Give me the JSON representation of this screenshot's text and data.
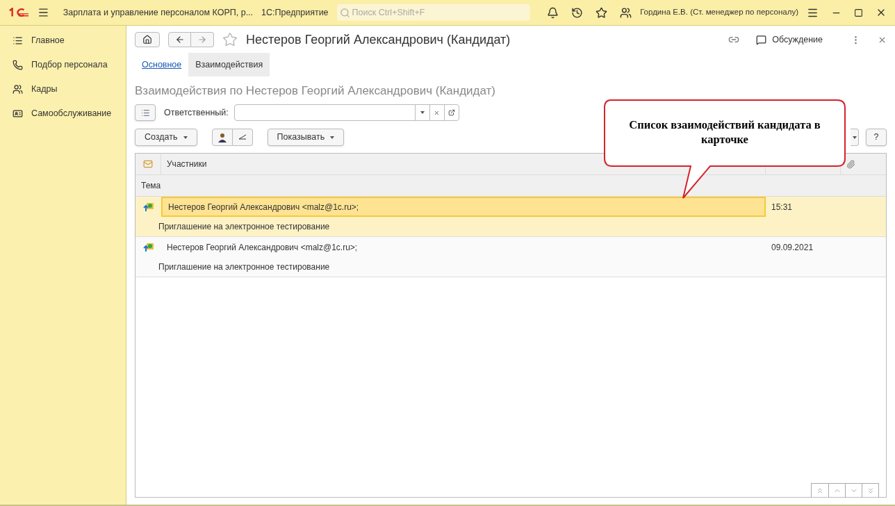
{
  "titlebar": {
    "app_title": "Зарплата и управление персоналом КОРП, р...",
    "platform": "1С:Предприятие",
    "search": {
      "placeholder": "Поиск Ctrl+Shift+F"
    },
    "user": "Гордина Е.В. (Ст. менеджер по персоналу)"
  },
  "sidebar": {
    "items": [
      {
        "label": "Главное",
        "selected": false
      },
      {
        "label": "Подбор персонала",
        "selected": false
      },
      {
        "label": "Кадры",
        "selected": false
      },
      {
        "label": "Самообслуживание",
        "selected": false
      }
    ]
  },
  "form": {
    "title": "Нестеров Георгий Александрович (Кандидат)",
    "discussion": "Обсуждение",
    "tabs": [
      {
        "label": "Основное",
        "selected": false
      },
      {
        "label": "Взаимодействия",
        "selected": true
      }
    ],
    "heading": "Взаимодействия по Нестеров Георгий Александрович (Кандидат)",
    "responsible_label": "Ответственный:",
    "buttons": {
      "create": "Создать",
      "show": "Показывать",
      "help": "?"
    },
    "table": {
      "columns": {
        "participants": "Участники",
        "subject": "Тема"
      },
      "rows": [
        {
          "participants": "Нестеров Георгий Александрович <malz@1c.ru>;",
          "date": "15:31",
          "subject": "Приглашение на электронное тестирование",
          "selected": true
        },
        {
          "participants": "Нестеров Георгий Александрович <malz@1c.ru>;",
          "date": "09.09.2021",
          "subject": "Приглашение на электронное тестирование",
          "selected": false
        }
      ]
    }
  },
  "callout": {
    "text": "Список взаимодействий кандидата в карточке"
  }
}
